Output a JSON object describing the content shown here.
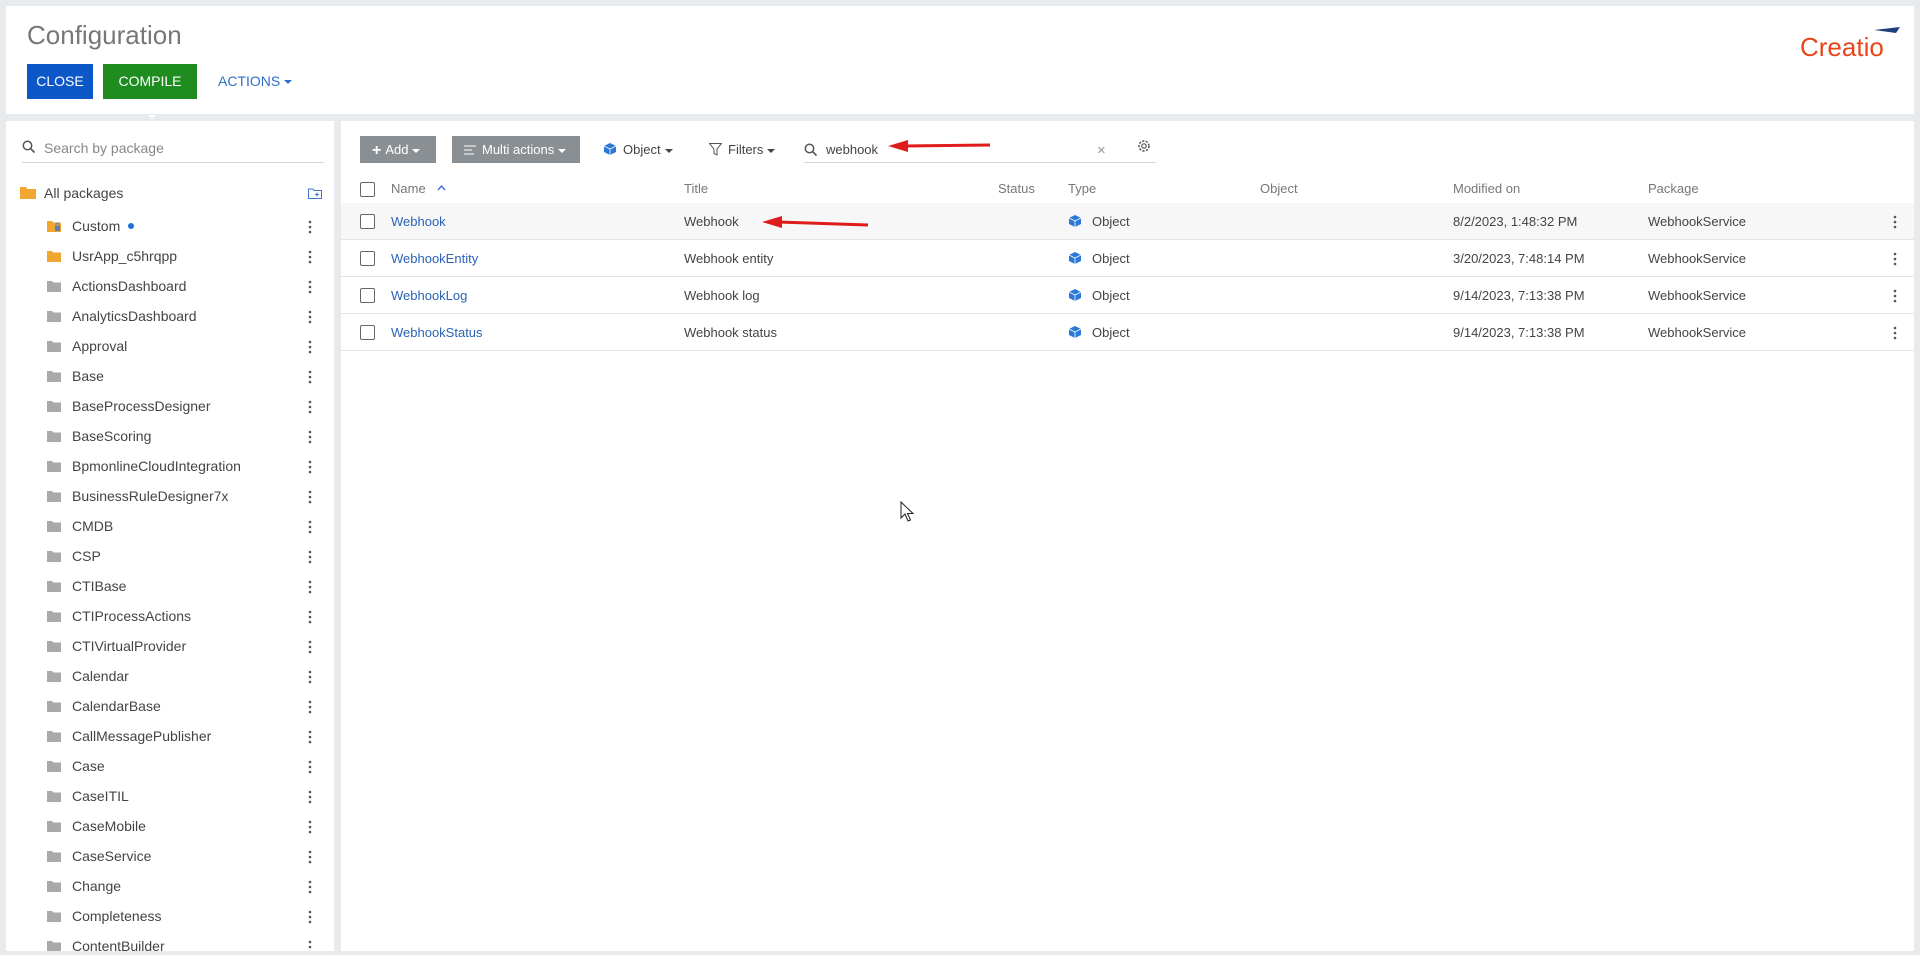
{
  "header": {
    "title": "Configuration",
    "close_label": "CLOSE",
    "compile_label": "COMPILE",
    "actions_label": "ACTIONS",
    "logo_text": "Creatio",
    "colors": {
      "close": "#0d58c8",
      "compile": "#1e8c1e",
      "link": "#2f6fc4",
      "logo": "#e7461b"
    }
  },
  "sidebar": {
    "search_placeholder": "Search by package",
    "all_packages_label": "All packages",
    "items": [
      {
        "label": "Custom",
        "icon": "locked-folder-icon",
        "active": true
      },
      {
        "label": "UsrApp_c5hrqpp",
        "icon": "folder-icon",
        "active": true
      },
      {
        "label": "ActionsDashboard",
        "icon": "folder-icon"
      },
      {
        "label": "AnalyticsDashboard",
        "icon": "folder-icon"
      },
      {
        "label": "Approval",
        "icon": "folder-icon"
      },
      {
        "label": "Base",
        "icon": "folder-icon"
      },
      {
        "label": "BaseProcessDesigner",
        "icon": "folder-icon"
      },
      {
        "label": "BaseScoring",
        "icon": "folder-icon"
      },
      {
        "label": "BpmonlineCloudIntegration",
        "icon": "folder-icon"
      },
      {
        "label": "BusinessRuleDesigner7x",
        "icon": "folder-icon"
      },
      {
        "label": "CMDB",
        "icon": "folder-icon"
      },
      {
        "label": "CSP",
        "icon": "folder-icon"
      },
      {
        "label": "CTIBase",
        "icon": "folder-icon"
      },
      {
        "label": "CTIProcessActions",
        "icon": "folder-icon"
      },
      {
        "label": "CTIVirtualProvider",
        "icon": "folder-icon"
      },
      {
        "label": "Calendar",
        "icon": "folder-icon"
      },
      {
        "label": "CalendarBase",
        "icon": "folder-icon"
      },
      {
        "label": "CallMessagePublisher",
        "icon": "folder-icon"
      },
      {
        "label": "Case",
        "icon": "folder-icon"
      },
      {
        "label": "CaseITIL",
        "icon": "folder-icon"
      },
      {
        "label": "CaseMobile",
        "icon": "folder-icon"
      },
      {
        "label": "CaseService",
        "icon": "folder-icon"
      },
      {
        "label": "Change",
        "icon": "folder-icon"
      },
      {
        "label": "Completeness",
        "icon": "folder-icon"
      },
      {
        "label": "ContentBuilder",
        "icon": "folder-icon"
      }
    ]
  },
  "toolbar": {
    "add_label": "Add",
    "multi_actions_label": "Multi actions",
    "object_label": "Object",
    "filters_label": "Filters",
    "search_value": "webhook"
  },
  "table": {
    "columns": {
      "name": "Name",
      "title": "Title",
      "status": "Status",
      "type": "Type",
      "object": "Object",
      "modified_on": "Modified on",
      "package": "Package"
    },
    "rows": [
      {
        "name": "Webhook",
        "title": "Webhook",
        "status": "",
        "type": "Object",
        "object": "",
        "modified_on": "8/2/2023, 1:48:32 PM",
        "package": "WebhookService"
      },
      {
        "name": "WebhookEntity",
        "title": "Webhook entity",
        "status": "",
        "type": "Object",
        "object": "",
        "modified_on": "3/20/2023, 7:48:14 PM",
        "package": "WebhookService"
      },
      {
        "name": "WebhookLog",
        "title": "Webhook log",
        "status": "",
        "type": "Object",
        "object": "",
        "modified_on": "9/14/2023, 7:13:38 PM",
        "package": "WebhookService"
      },
      {
        "name": "WebhookStatus",
        "title": "Webhook status",
        "status": "",
        "type": "Object",
        "object": "",
        "modified_on": "9/14/2023, 7:13:38 PM",
        "package": "WebhookService"
      }
    ]
  }
}
